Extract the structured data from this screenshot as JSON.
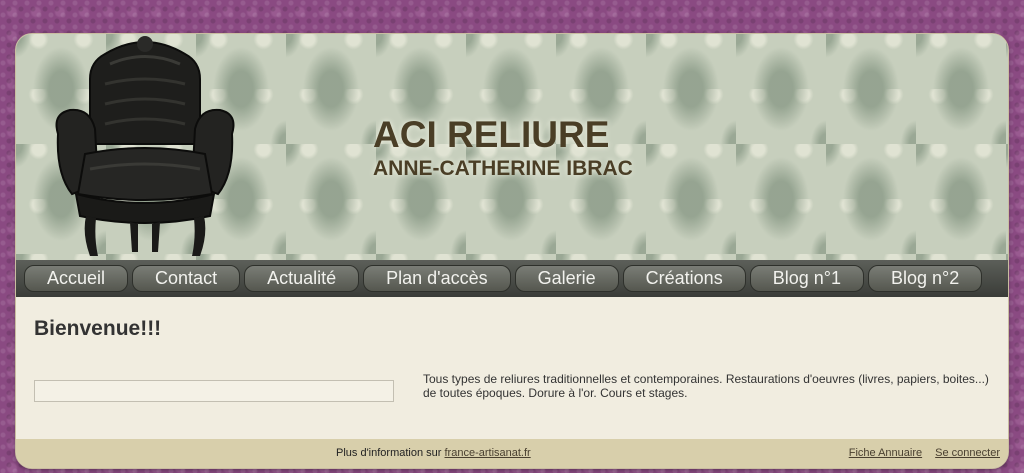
{
  "header": {
    "title": "ACI RELIURE",
    "subtitle": "ANNE-CATHERINE IBRAC"
  },
  "nav": {
    "items": [
      {
        "label": "Accueil"
      },
      {
        "label": "Contact"
      },
      {
        "label": "Actualité"
      },
      {
        "label": "Plan d'accès"
      },
      {
        "label": "Galerie"
      },
      {
        "label": "Créations"
      },
      {
        "label": "Blog n°1"
      },
      {
        "label": "Blog n°2"
      }
    ]
  },
  "content": {
    "heading": "Bienvenue!!!",
    "description": "Tous types de reliures traditionnelles et contemporaines. Restaurations d'oeuvres (livres, papiers, boites...) de toutes époques. Dorure à l'or. Cours et stages."
  },
  "footer": {
    "info_prefix": "Plus d'information sur",
    "info_link": "france-artisanat.fr",
    "directory_link": "Fiche Annuaire",
    "login_link": "Se connecter"
  },
  "colors": {
    "page_background": "#8a4a82",
    "content_background": "#f1ede0",
    "title_color": "#4a3e26",
    "nav_background": "#4a4c47",
    "footer_background": "#d8cfab"
  },
  "icons": {
    "header_image": "armchair-icon"
  }
}
